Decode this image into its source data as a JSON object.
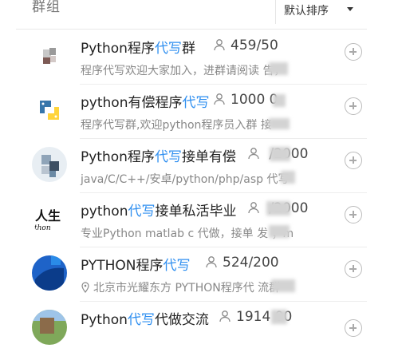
{
  "header": {
    "title": "群组",
    "sort_label": "默认排序"
  },
  "groups": [
    {
      "name_pre": "Python程序",
      "name_hl": "代写",
      "name_post": "群",
      "members": "459/50",
      "desc": "程序代写欢迎大家加入，进群请阅读      告，",
      "has_location": false
    },
    {
      "name_pre": "python有偿程序",
      "name_hl": "代写",
      "name_post": "",
      "members": "1000     0",
      "desc": "程序代写群,欢迎python程序员入群     接",
      "has_location": false
    },
    {
      "name_pre": "Python程序",
      "name_hl": "代写",
      "name_post": "接单有偿",
      "members": "      /2000",
      "desc": "java/C/C++/安卓/python/php/asp   代写",
      "has_location": false
    },
    {
      "name_pre": "python",
      "name_hl": "代写",
      "name_post": "接单私活毕业",
      "members": "      /2000",
      "desc": "专业Python matlab c 代做，接单 发    ；m",
      "has_location": false
    },
    {
      "name_pre": "PYTHON程序",
      "name_hl": "代写",
      "name_post": "",
      "members": "524/200",
      "desc": "北京市光耀东方  PYTHON程序代       流群",
      "has_location": true
    },
    {
      "name_pre": "Python",
      "name_hl": "代写",
      "name_post": "代做交流",
      "members": "1914   00",
      "desc": "",
      "has_location": false
    }
  ],
  "colors": {
    "highlight": "#2f8ff0",
    "text": "#222222",
    "muted": "#888888"
  },
  "icons": {
    "member": "person-icon",
    "add": "plus-circle-icon",
    "location": "pin-icon",
    "sort": "caret-down-icon"
  }
}
